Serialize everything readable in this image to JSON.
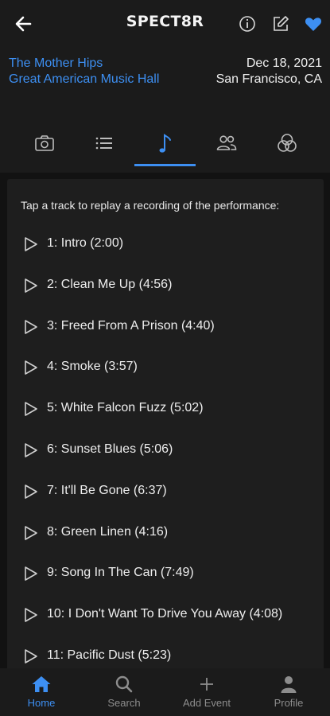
{
  "header": {
    "brand": "SPECT8R",
    "back_icon": "arrow-left-icon",
    "info_icon": "info-icon",
    "edit_icon": "edit-icon",
    "favorite_icon": "heart-icon",
    "accent": "#3d8ff2"
  },
  "event": {
    "artist": "The Mother Hips",
    "venue": "Great American Music Hall",
    "date": "Dec 18, 2021",
    "location": "San Francisco, CA"
  },
  "tabs": [
    {
      "icon": "camera-icon"
    },
    {
      "icon": "list-icon"
    },
    {
      "icon": "music-note-icon",
      "active": true
    },
    {
      "icon": "people-icon"
    },
    {
      "icon": "circles-icon"
    }
  ],
  "setlist": {
    "instruction": "Tap a track to replay a recording of the performance:",
    "tracks": [
      "1: Intro (2:00)",
      "2: Clean Me Up (4:56)",
      "3: Freed From A Prison (4:40)",
      "4: Smoke (3:57)",
      "5: White Falcon Fuzz (5:02)",
      "6: Sunset Blues (5:06)",
      "7: It'll Be Gone (6:37)",
      "8: Green Linen (4:16)",
      "9: Song In The Can (7:49)",
      "10: I Don't Want To Drive You Away (4:08)",
      "11: Pacific Dust (5:23)"
    ]
  },
  "bottom_nav": {
    "home": "Home",
    "search": "Search",
    "add_event": "Add Event",
    "profile": "Profile"
  }
}
